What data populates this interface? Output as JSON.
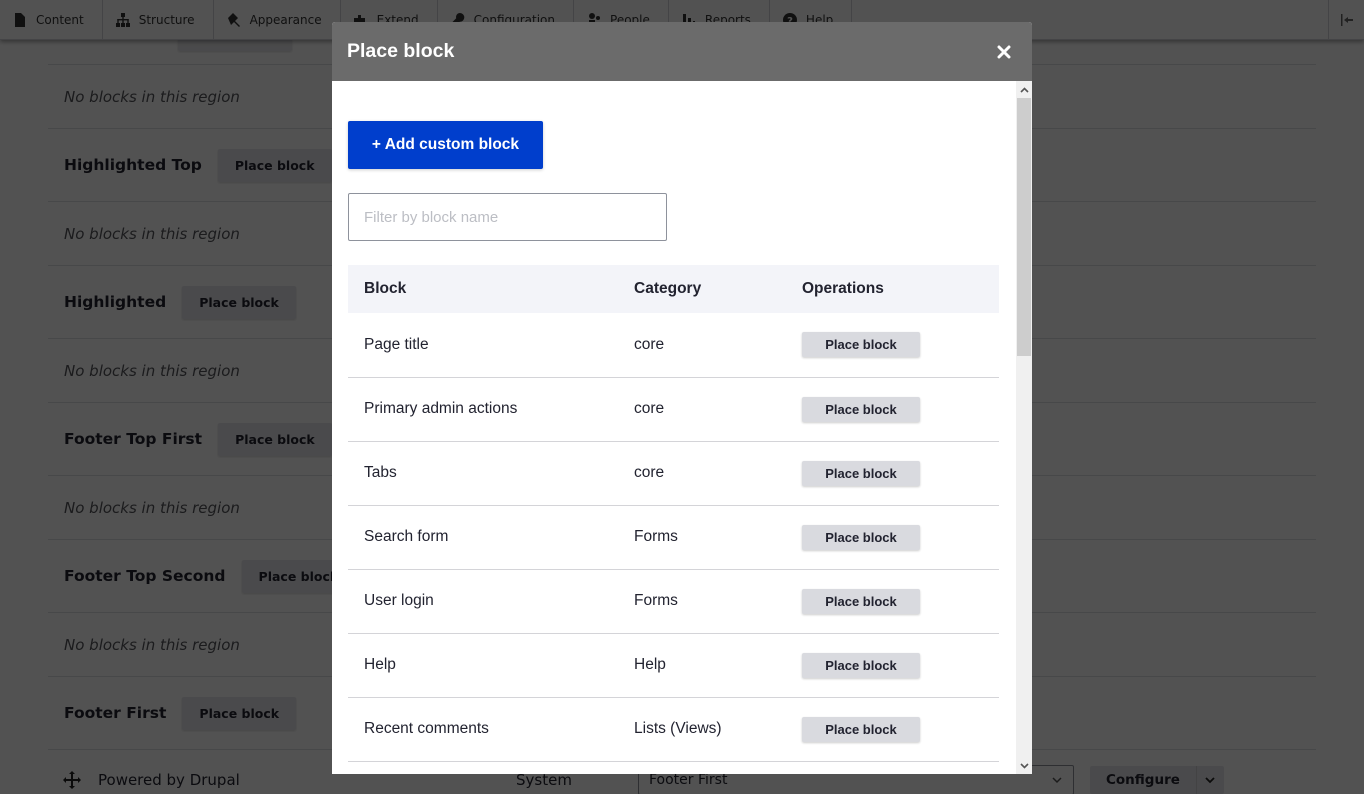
{
  "toolbar": {
    "items": [
      {
        "label": "Content",
        "icon": "file-icon"
      },
      {
        "label": "Structure",
        "icon": "sitemap-icon"
      },
      {
        "label": "Appearance",
        "icon": "paintbrush-icon"
      },
      {
        "label": "Extend",
        "icon": "puzzle-icon"
      },
      {
        "label": "Configuration",
        "icon": "wrench-icon"
      },
      {
        "label": "People",
        "icon": "person-icon"
      },
      {
        "label": "Reports",
        "icon": "bar-chart-icon"
      },
      {
        "label": "Help",
        "icon": "question-icon"
      }
    ]
  },
  "background": {
    "first_place_block_label": "Place block",
    "empty_text": "No blocks in this region",
    "regions": [
      {
        "title": "Highlighted Top",
        "button": "Place block"
      },
      {
        "title": "Highlighted",
        "button": "Place block"
      },
      {
        "title": "Footer Top First",
        "button": "Place block"
      },
      {
        "title": "Footer Top Second",
        "button": "Place block"
      },
      {
        "title": "Footer First",
        "button": "Place block"
      }
    ],
    "block_row": {
      "name": "Powered by Drupal",
      "category": "System",
      "region": "Footer First",
      "configure_label": "Configure"
    }
  },
  "dialog": {
    "title": "Place block",
    "add_button": "+ Add custom block",
    "filter_placeholder": "Filter by block name",
    "filter_value": "",
    "columns": {
      "block": "Block",
      "category": "Category",
      "operations": "Operations"
    },
    "rows": [
      {
        "block": "Page title",
        "category": "core",
        "op": "Place block"
      },
      {
        "block": "Primary admin actions",
        "category": "core",
        "op": "Place block"
      },
      {
        "block": "Tabs",
        "category": "core",
        "op": "Place block"
      },
      {
        "block": "Search form",
        "category": "Forms",
        "op": "Place block"
      },
      {
        "block": "User login",
        "category": "Forms",
        "op": "Place block"
      },
      {
        "block": "Help",
        "category": "Help",
        "op": "Place block"
      },
      {
        "block": "Recent comments",
        "category": "Lists (Views)",
        "op": "Place block"
      }
    ]
  },
  "colors": {
    "primary": "#003ecc",
    "dialog_titlebar": "#6b6b6b",
    "table_header": "#f3f4f9",
    "place_button": "#d9dadf"
  }
}
